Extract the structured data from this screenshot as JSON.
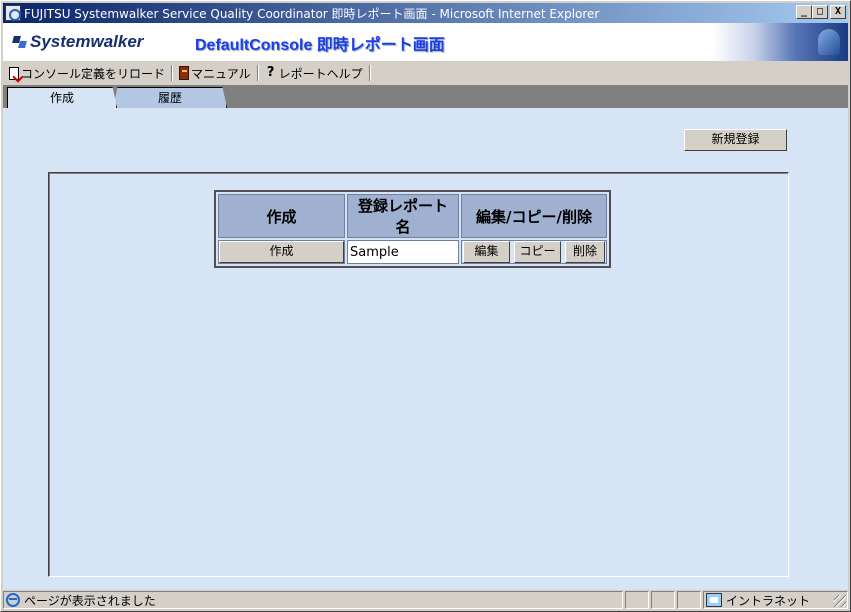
{
  "window": {
    "title": "FUJITSU Systemwalker Service Quality Coordinator 即時レポート画面 - Microsoft Internet Explorer",
    "minimize": "_",
    "maximize": "□",
    "close": "X"
  },
  "banner": {
    "logo": "Systemwalker",
    "console_title": "DefaultConsole 即時レポート画面"
  },
  "toolbar": {
    "items": [
      {
        "label": "コンソール定義をリロード",
        "icon": "reload-icon"
      },
      {
        "label": "マニュアル",
        "icon": "book-icon"
      },
      {
        "label": "レポートヘルプ",
        "icon": "help-icon"
      }
    ],
    "help_glyph": "?"
  },
  "tabs": [
    {
      "label": "作成",
      "active": true
    },
    {
      "label": "履歴",
      "active": false
    }
  ],
  "main": {
    "new_button": "新規登録",
    "table": {
      "headers": [
        "作成",
        "登録レポート名",
        "編集/コピー/削除"
      ],
      "rows": [
        {
          "create_button": "作成",
          "name": "Sample",
          "edit": "編集",
          "copy": "コピー",
          "delete": "削除"
        }
      ]
    }
  },
  "status": {
    "message": "ページが表示されました",
    "zone": "イントラネット"
  },
  "colors": {
    "content_bg": "#d6e4f6",
    "header_bg": "#9fb0d0",
    "title_gradient_start": "#0a246a",
    "console_title": "#1a3cf0"
  }
}
